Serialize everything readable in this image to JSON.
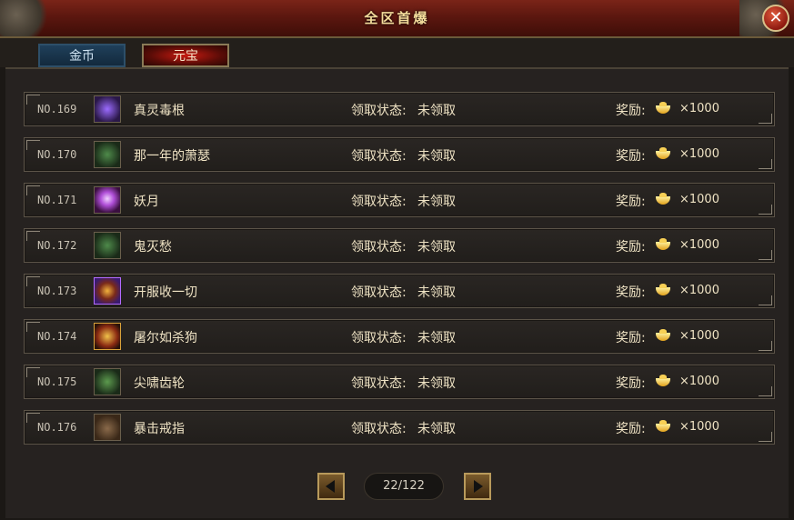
{
  "window": {
    "title": "全区首爆",
    "close_glyph": "✕"
  },
  "tabs": [
    {
      "label": "金币",
      "active": false
    },
    {
      "label": "元宝",
      "active": true
    }
  ],
  "rows": [
    {
      "rank": "NO.169",
      "icon": "purple-claw-icon",
      "name": "真灵毒根",
      "status_label": "领取状态:",
      "status": "未领取",
      "reward_label": "奖励:",
      "reward_icon": "gold-ingot-icon",
      "reward": "×1000"
    },
    {
      "rank": "NO.170",
      "icon": "green-armor-icon",
      "name": "那一年的萧瑟",
      "status_label": "领取状态:",
      "status": "未领取",
      "reward_label": "奖励:",
      "reward_icon": "gold-ingot-icon",
      "reward": "×1000"
    },
    {
      "rank": "NO.171",
      "icon": "purple-orb-icon",
      "name": "妖月",
      "status_label": "领取状态:",
      "status": "未领取",
      "reward_label": "奖励:",
      "reward_icon": "gold-ingot-icon",
      "reward": "×1000"
    },
    {
      "rank": "NO.172",
      "icon": "green-armor-icon",
      "name": "鬼灭愁",
      "status_label": "领取状态:",
      "status": "未领取",
      "reward_label": "奖励:",
      "reward_icon": "gold-ingot-icon",
      "reward": "×1000"
    },
    {
      "rank": "NO.173",
      "icon": "glowing-sword-icon",
      "name": "开服收一切",
      "status_label": "领取状态:",
      "status": "未领取",
      "reward_label": "奖励:",
      "reward_icon": "gold-ingot-icon",
      "reward": "×1000"
    },
    {
      "rank": "NO.174",
      "icon": "golden-blade-icon",
      "name": "屠尔如杀狗",
      "status_label": "领取状态:",
      "status": "未领取",
      "reward_label": "奖励:",
      "reward_icon": "gold-ingot-icon",
      "reward": "×1000"
    },
    {
      "rank": "NO.175",
      "icon": "green-armor-icon",
      "name": "尖啸齿轮",
      "status_label": "领取状态:",
      "status": "未领取",
      "reward_label": "奖励:",
      "reward_icon": "gold-ingot-icon",
      "reward": "×1000"
    },
    {
      "rank": "NO.176",
      "icon": "brown-ring-icon",
      "name": "暴击戒指",
      "status_label": "领取状态:",
      "status": "未领取",
      "reward_label": "奖励:",
      "reward_icon": "gold-ingot-icon",
      "reward": "×1000"
    }
  ],
  "pager": {
    "page": "22/122"
  },
  "colors": {
    "title_text": "#f3dc9b",
    "row_text": "#efe3c4",
    "active_tab": "#c91a10",
    "inactive_tab": "#1f3f5a"
  }
}
